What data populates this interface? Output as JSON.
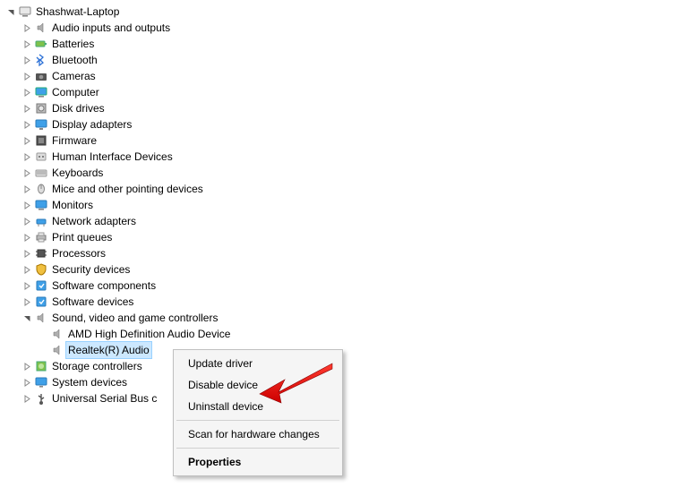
{
  "root": {
    "label": "Shashwat-Laptop"
  },
  "children": [
    {
      "label": "Audio inputs and outputs",
      "icon": "speaker"
    },
    {
      "label": "Batteries",
      "icon": "battery"
    },
    {
      "label": "Bluetooth",
      "icon": "bluetooth"
    },
    {
      "label": "Cameras",
      "icon": "camera"
    },
    {
      "label": "Computer",
      "icon": "computer"
    },
    {
      "label": "Disk drives",
      "icon": "disk"
    },
    {
      "label": "Display adapters",
      "icon": "display"
    },
    {
      "label": "Firmware",
      "icon": "firmware"
    },
    {
      "label": "Human Interface Devices",
      "icon": "hid"
    },
    {
      "label": "Keyboards",
      "icon": "keyboard"
    },
    {
      "label": "Mice and other pointing devices",
      "icon": "mouse"
    },
    {
      "label": "Monitors",
      "icon": "monitor"
    },
    {
      "label": "Network adapters",
      "icon": "network"
    },
    {
      "label": "Print queues",
      "icon": "printer"
    },
    {
      "label": "Processors",
      "icon": "processor"
    },
    {
      "label": "Security devices",
      "icon": "security"
    },
    {
      "label": "Software components",
      "icon": "software"
    },
    {
      "label": "Software devices",
      "icon": "software"
    }
  ],
  "sound": {
    "label": "Sound, video and game controllers",
    "children": [
      {
        "label": "AMD High Definition Audio Device"
      },
      {
        "label": "Realtek(R) Audio",
        "selected": true
      }
    ]
  },
  "after": [
    {
      "label": "Storage controllers",
      "icon": "storage"
    },
    {
      "label": "System devices",
      "icon": "system"
    },
    {
      "label": "Universal Serial Bus c",
      "icon": "usb"
    }
  ],
  "menu": {
    "items": [
      "Update driver",
      "Disable device",
      "Uninstall device"
    ],
    "items2": [
      "Scan for hardware changes"
    ],
    "items3": [
      "Properties"
    ]
  }
}
